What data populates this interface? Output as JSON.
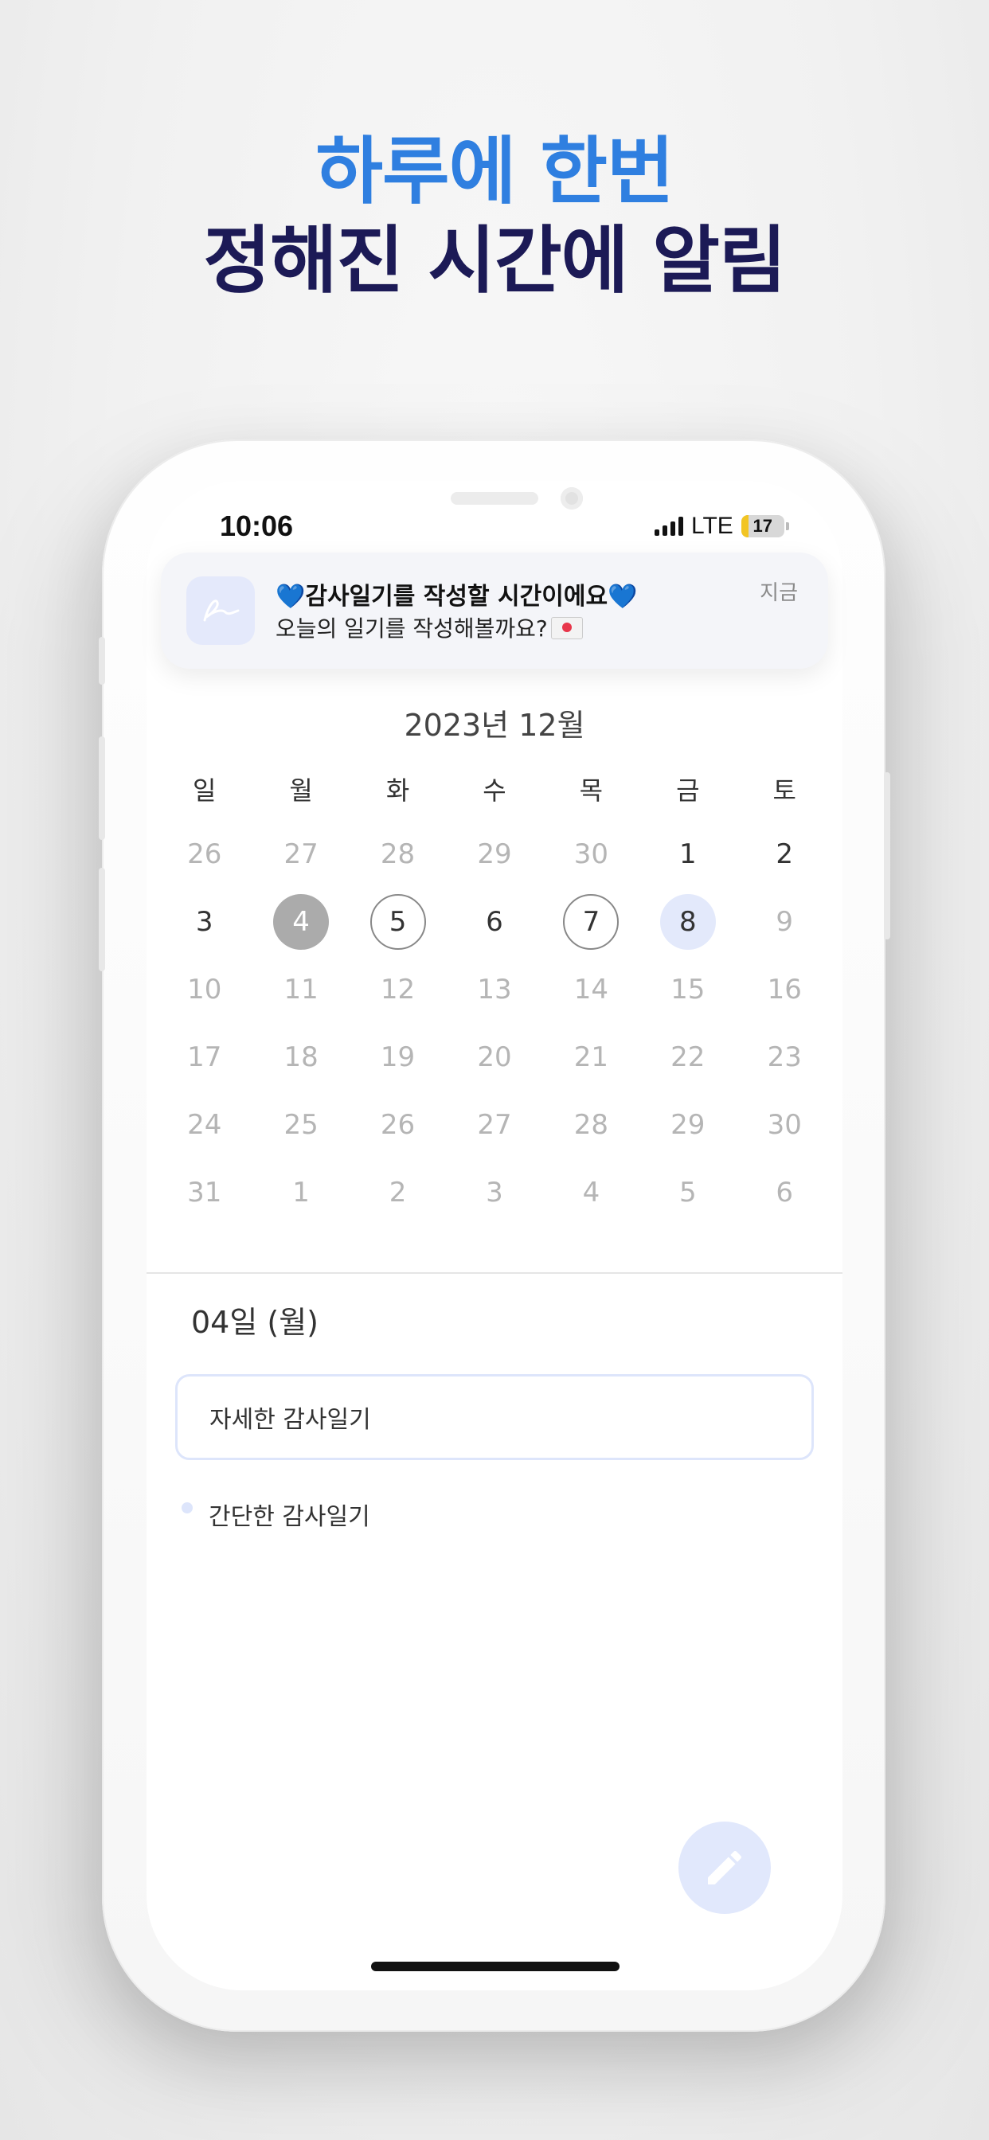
{
  "headline": {
    "line1": "하루에 한번",
    "line2": "정해진 시간에 알림",
    "line1_color": "#2f7fe0",
    "line2_color": "#1c1a56"
  },
  "status_bar": {
    "time": "10:06",
    "network": "LTE",
    "battery": "17",
    "battery_level": 0.17
  },
  "notification": {
    "title_prefix_icon": "blue-heart-icon",
    "title": "감사일기를 작성할 시간이에요",
    "title_suffix_icon": "blue-heart-icon",
    "body": "오늘의 일기를 작성해볼까요?",
    "body_icon": "love-letter-icon",
    "time": "지금",
    "app_icon": "signature-icon"
  },
  "calendar": {
    "month_title": "2023년 12월",
    "weekdays": [
      "일",
      "월",
      "화",
      "수",
      "목",
      "금",
      "토"
    ],
    "weeks": [
      [
        {
          "d": "26",
          "s": "dim"
        },
        {
          "d": "27",
          "s": "dim"
        },
        {
          "d": "28",
          "s": "dim"
        },
        {
          "d": "29",
          "s": "dim"
        },
        {
          "d": "30",
          "s": "dim"
        },
        {
          "d": "1",
          "s": "cur"
        },
        {
          "d": "2",
          "s": "cur"
        }
      ],
      [
        {
          "d": "3",
          "s": "cur"
        },
        {
          "d": "4",
          "s": "selected"
        },
        {
          "d": "5",
          "s": "outlined"
        },
        {
          "d": "6",
          "s": "cur"
        },
        {
          "d": "7",
          "s": "outlined"
        },
        {
          "d": "8",
          "s": "today"
        },
        {
          "d": "9",
          "s": "dim"
        }
      ],
      [
        {
          "d": "10",
          "s": "dim"
        },
        {
          "d": "11",
          "s": "dim"
        },
        {
          "d": "12",
          "s": "dim"
        },
        {
          "d": "13",
          "s": "dim"
        },
        {
          "d": "14",
          "s": "dim"
        },
        {
          "d": "15",
          "s": "dim"
        },
        {
          "d": "16",
          "s": "dim"
        }
      ],
      [
        {
          "d": "17",
          "s": "dim"
        },
        {
          "d": "18",
          "s": "dim"
        },
        {
          "d": "19",
          "s": "dim"
        },
        {
          "d": "20",
          "s": "dim"
        },
        {
          "d": "21",
          "s": "dim"
        },
        {
          "d": "22",
          "s": "dim"
        },
        {
          "d": "23",
          "s": "dim"
        }
      ],
      [
        {
          "d": "24",
          "s": "dim"
        },
        {
          "d": "25",
          "s": "dim"
        },
        {
          "d": "26",
          "s": "dim"
        },
        {
          "d": "27",
          "s": "dim"
        },
        {
          "d": "28",
          "s": "dim"
        },
        {
          "d": "29",
          "s": "dim"
        },
        {
          "d": "30",
          "s": "dim"
        }
      ],
      [
        {
          "d": "31",
          "s": "dim"
        },
        {
          "d": "1",
          "s": "dim"
        },
        {
          "d": "2",
          "s": "dim"
        },
        {
          "d": "3",
          "s": "dim"
        },
        {
          "d": "4",
          "s": "dim"
        },
        {
          "d": "5",
          "s": "dim"
        },
        {
          "d": "6",
          "s": "dim"
        }
      ]
    ]
  },
  "day_detail": {
    "date_label": "04일 (월)",
    "detail_entry": "자세한 감사일기",
    "simple_entry": "간단한 감사일기"
  },
  "fab": {
    "icon": "pencil-icon",
    "color": "#e1e8fc"
  }
}
